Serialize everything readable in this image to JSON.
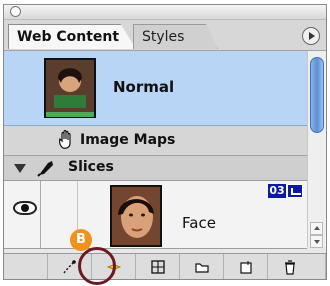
{
  "tabs": [
    {
      "label": "Web Content",
      "active": true
    },
    {
      "label": "Styles",
      "active": false
    }
  ],
  "rows": {
    "normal": {
      "label": "Normal",
      "selected": true
    },
    "image_maps": {
      "label": "Image Maps"
    },
    "slices": {
      "label": "Slices",
      "expanded": true
    },
    "face": {
      "label": "Face",
      "slice_number": "03"
    }
  },
  "callout": {
    "label": "B"
  },
  "icons": {
    "panel_menu": "circle-right-arrow-icon",
    "image_maps": "hand-icon",
    "slices": "slice-tool-icon",
    "visibility": "eye-icon",
    "image_badge": "image-icon",
    "toolbar": [
      "pen-icon",
      "sparkle-icon",
      "grid-icon",
      "folder-icon",
      "new-layer-icon",
      "trash-icon"
    ]
  },
  "colors": {
    "selection": "#b8d5f6",
    "badge": "#0b1aa4",
    "callout": "#f2911b",
    "scroll_thumb": "#5b8fd6"
  }
}
